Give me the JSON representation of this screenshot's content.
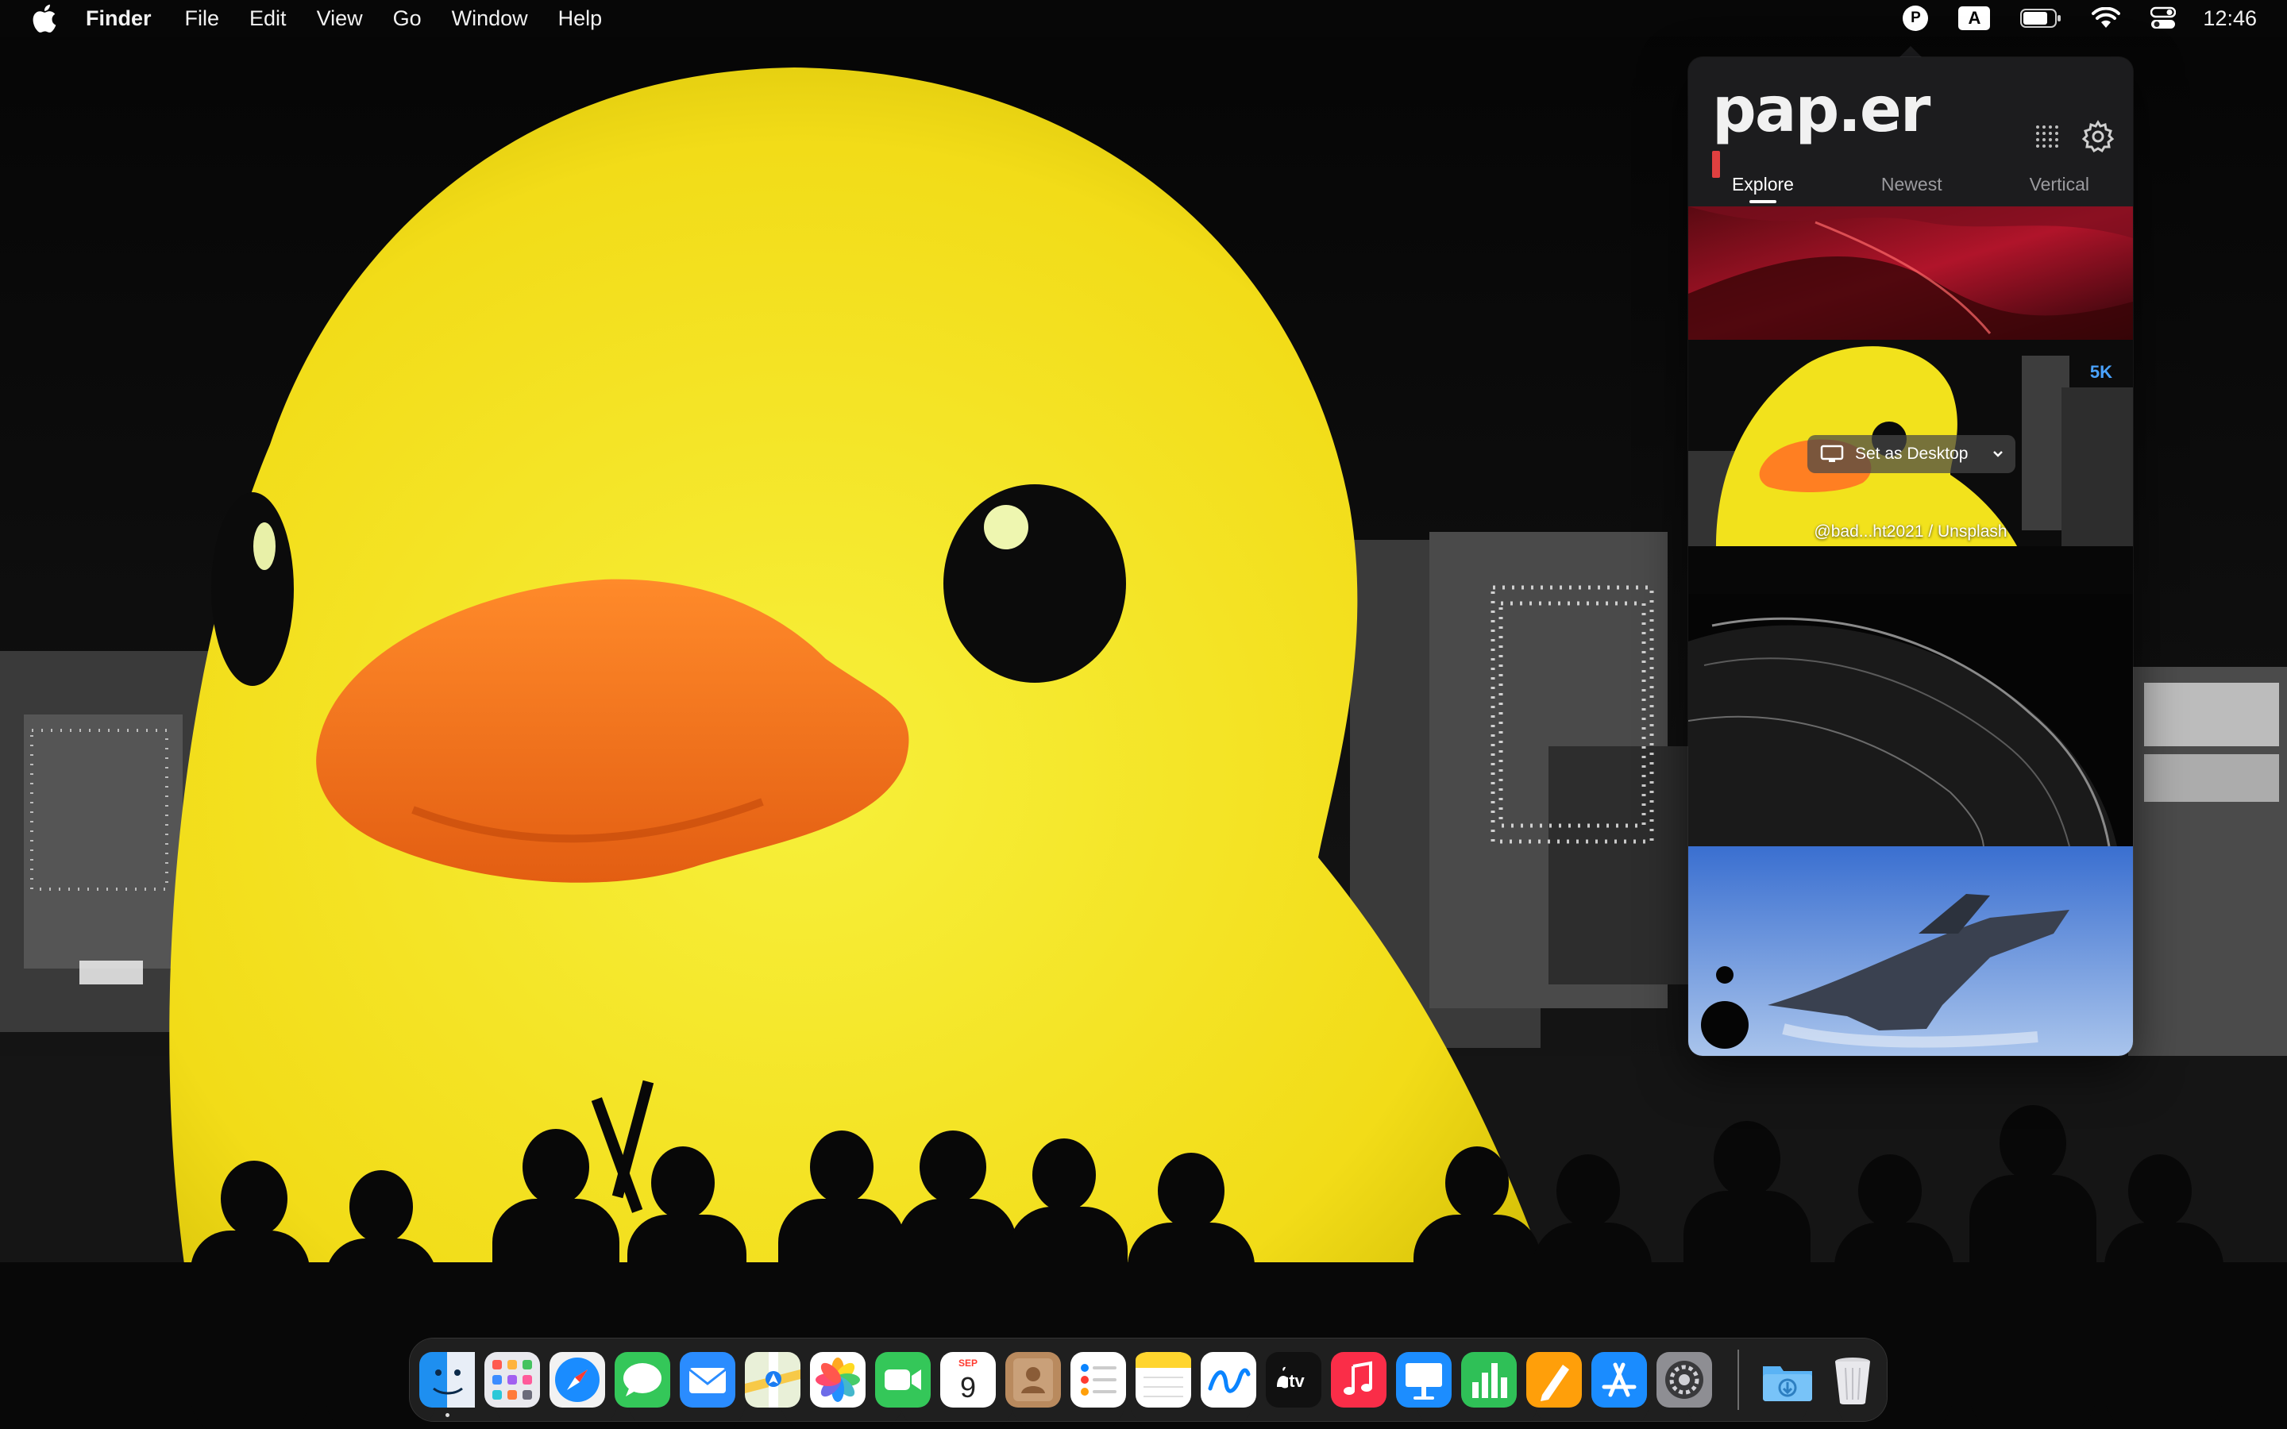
{
  "menubar": {
    "app_name": "Finder",
    "menus": [
      "File",
      "Edit",
      "View",
      "Go",
      "Window",
      "Help"
    ],
    "input_source": "A",
    "paper_icon_letter": "P",
    "clock": "12:46"
  },
  "paper_panel": {
    "logo": "pap.er",
    "tabs": [
      "Explore",
      "Newest",
      "Vertical"
    ],
    "active_tab": "Explore",
    "thumbnails": [
      {
        "name": "red-abstract-wave"
      },
      {
        "name": "rubber-duck-night",
        "resolution": "5K",
        "action_label": "Set as Desktop",
        "credit": "@bad...ht2021 / Unsplash"
      },
      {
        "name": "black-abstract-folds"
      },
      {
        "name": "fighter-jet-blue-sky"
      }
    ]
  },
  "dock": {
    "apps": [
      "Finder",
      "Launchpad",
      "Safari",
      "Messages",
      "Mail",
      "Maps",
      "Photos",
      "FaceTime",
      "Calendar",
      "Contacts",
      "Reminders",
      "Notes",
      "Freeform",
      "TV",
      "Music",
      "Keynote",
      "Numbers",
      "Pages",
      "App Store",
      "System Settings"
    ],
    "calendar_month": "SEP",
    "calendar_day": "9",
    "tv_label": "tv",
    "extras": [
      "Downloads",
      "Trash"
    ]
  }
}
